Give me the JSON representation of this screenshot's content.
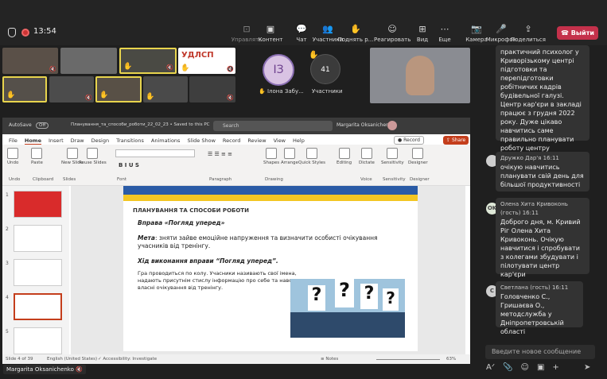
{
  "topbar": {
    "time": "13:54",
    "buttons": [
      {
        "label": "Управлять",
        "icon": "control-icon",
        "dim": true
      },
      {
        "label": "Контент",
        "icon": "share-content-icon"
      },
      {
        "label": "Чат",
        "icon": "chat-icon"
      },
      {
        "label": "Участники",
        "icon": "participants-icon"
      },
      {
        "label": "Поднять р...",
        "icon": "raise-hand-icon"
      },
      {
        "label": "Реагировать",
        "icon": "react-icon"
      },
      {
        "label": "Вид",
        "icon": "view-icon"
      },
      {
        "label": "Еще",
        "icon": "more-icon"
      },
      {
        "label": "Камера",
        "icon": "camera-icon"
      },
      {
        "label": "Микрофон",
        "icon": "microphone-icon"
      },
      {
        "label": "Поделиться",
        "icon": "share-icon"
      }
    ],
    "leave_label": "Выйти"
  },
  "participants": {
    "avatar_initials": "IЗ",
    "avatar_name": "Ілона Забу...",
    "count": "41",
    "count_label": "Участники",
    "logo_text": "УДЛСП",
    "presenter": "Margarita Oksanichenko"
  },
  "ppt": {
    "autosave": "AutoSave",
    "autosave_state": "Off",
    "filename": "Планування_та_способи_роботи_22_02_23 • Saved to this PC",
    "search": "Search",
    "user": "Margarita Oksanichenko",
    "menu": [
      "File",
      "Home",
      "Insert",
      "Draw",
      "Design",
      "Transitions",
      "Animations",
      "Slide Show",
      "Record",
      "Review",
      "View",
      "Help"
    ],
    "record_label": "Record",
    "share_label": "Share",
    "ribbon_groups": [
      {
        "btns": [
          "Undo"
        ],
        "label": "Undo"
      },
      {
        "btns": [
          "Paste"
        ],
        "label": "Clipboard"
      },
      {
        "btns": [
          "New Slide",
          "Reuse Slides"
        ],
        "label": "Slides"
      },
      {
        "btns": [],
        "label": "Font"
      },
      {
        "btns": [],
        "label": "Paragraph"
      },
      {
        "btns": [
          "Shapes",
          "Arrange",
          "Quick Styles"
        ],
        "label": "Drawing"
      },
      {
        "btns": [
          "Editing"
        ],
        "label": ""
      },
      {
        "btns": [
          "Dictate"
        ],
        "label": "Voice"
      },
      {
        "btns": [
          "Sensitivity"
        ],
        "label": "Sensitivity"
      },
      {
        "btns": [
          "Designer"
        ],
        "label": "Designer"
      }
    ],
    "thumb_numbers": [
      "1",
      "2",
      "3",
      "4",
      "5"
    ],
    "slide": {
      "heading": "ПЛАНУВАННЯ ТА СПОСОБИ РОБОТИ",
      "exercise": "Вправа «Погляд уперед»",
      "goal_label": "Мета",
      "goal_text": ": зняти зайве емоційне напруження та визначити особисті очікування учасників від тренінгу.",
      "course_title": "Хід виконання вправи “Погляд уперед”.",
      "course_text": "Гра проводиться по колу. Учасники називають свої імена, надають присутнім стислу інформацію про себе та наводять власні очікування від тренінгу."
    },
    "status": {
      "slide": "Slide 4 of 39",
      "lang": "English (United States)",
      "access": "Accessibility: Investigate",
      "notes": "Notes",
      "zoom": "63%"
    }
  },
  "chat": {
    "messages": [
      {
        "text": "практичний психолог у Криворізькому центрі підготовки та перепідготовки робітничих кадрів будівельної галузі. Центр кар'єри в закладі працює з грудня 2022 року. Дуже цікаво навчитись саме правильно планувати роботу центру"
      },
      {
        "name": "Дружко Дар'я",
        "time": "16:11",
        "initials": "",
        "text": "очікую навчитись планувати свій день для більшої продуктивності"
      },
      {
        "name": "Олена Хита Кривоконь (гость)",
        "time": "16:11",
        "initials": "OK",
        "text": "Доброго дня, м. Кривий Ріг Олена Хита Кривоконь. Очікую навчитися і спробувати з колегами збудувати і пілотувати центр кар'єри"
      },
      {
        "name": "Светлана (гость)",
        "time": "16:11",
        "initials": "C",
        "text": "Головченко С., Гришаєва О., методслужба у Дніпропетровській області"
      }
    ],
    "input_placeholder": "Введите новое сообщение"
  }
}
